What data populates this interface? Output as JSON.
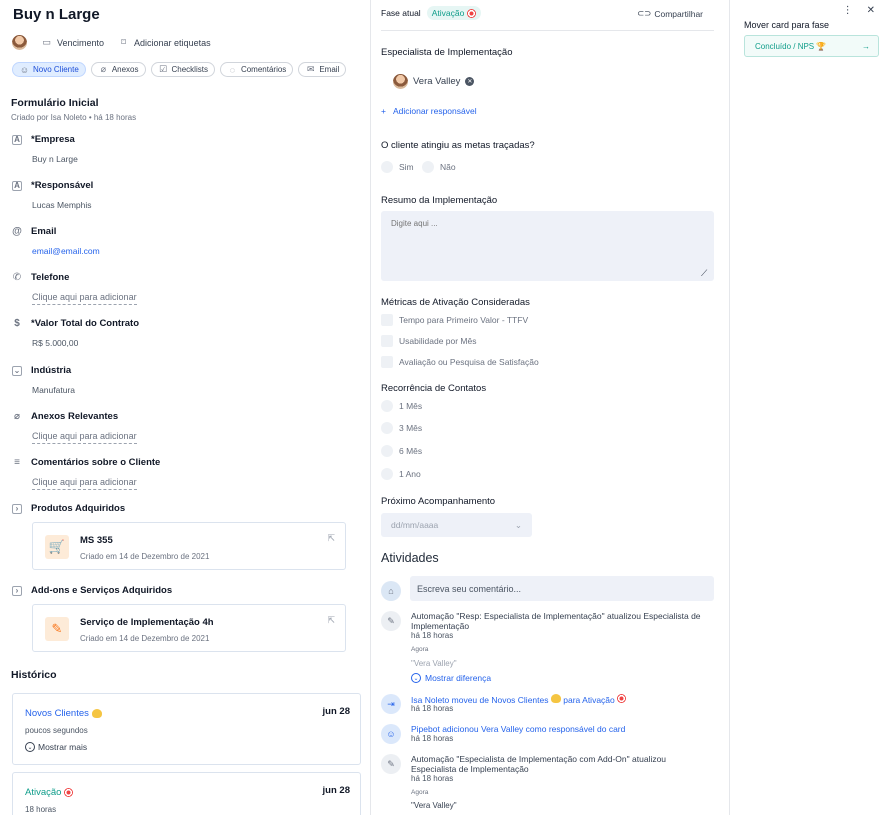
{
  "card": {
    "title": "Buy n Large",
    "due_label": "Vencimento",
    "tags_label": "Adicionar etiquetas"
  },
  "tabs": [
    "Novo Cliente",
    "Anexos",
    "Checklists",
    "Comentários",
    "Email"
  ],
  "form": {
    "title": "Formulário Inicial",
    "created": "Criado por Isa Noleto • há 18 horas",
    "fields": {
      "empresa": {
        "label": "*Empresa",
        "value": "Buy n Large"
      },
      "responsavel": {
        "label": "*Responsável",
        "value": "Lucas Memphis"
      },
      "email": {
        "label": "Email",
        "value": "email@email.com"
      },
      "telefone": {
        "label": "Telefone",
        "value": "Clique aqui para adicionar"
      },
      "valor": {
        "label": "*Valor Total do Contrato",
        "value": "R$ 5.000,00"
      },
      "industria": {
        "label": "Indústria",
        "value": "Manufatura"
      },
      "anexos": {
        "label": "Anexos Relevantes",
        "value": "Clique aqui para adicionar"
      },
      "comentarios": {
        "label": "Comentários sobre o Cliente",
        "value": "Clique aqui para adicionar"
      },
      "produtos": {
        "label": "Produtos Adquiridos"
      },
      "addons": {
        "label": "Add-ons e Serviços Adquiridos"
      }
    },
    "produto_card": {
      "name": "MS 355",
      "date": "Criado em 14 de Dezembro de 2021"
    },
    "addon_card": {
      "name": "Serviço de Implementação 4h",
      "date": "Criado em 14 de Dezembro de 2021"
    }
  },
  "history": {
    "title": "Histórico",
    "items": [
      {
        "phase": "Novos Clientes",
        "date": "jun 28",
        "when": "poucos segundos",
        "more": "Mostrar mais"
      },
      {
        "phase": "Ativação",
        "date": "jun 28",
        "when": "18 horas"
      }
    ]
  },
  "phase": {
    "label": "Fase atual",
    "current": "Ativação",
    "share": "Compartilhar"
  },
  "implementation": {
    "specialist_label": "Especialista de Implementação",
    "specialist_name": "Vera Valley",
    "add_responsible": "Adicionar responsável",
    "goals_question": "O cliente atingiu as metas traçadas?",
    "goals_options": [
      "Sim",
      "Não"
    ],
    "summary_label": "Resumo da Implementação",
    "summary_placeholder": "Digite aqui ...",
    "metrics_label": "Métricas de Ativação Consideradas",
    "metrics": [
      "Tempo para Primeiro Valor - TTFV",
      "Usabilidade por Mês",
      "Avaliação ou Pesquisa de Satisfação"
    ],
    "recurrence_label": "Recorrência de Contatos",
    "recurrence": [
      "1 Mês",
      "3 Mês",
      "6 Mês",
      "1 Ano"
    ],
    "next_label": "Próximo Acompanhamento",
    "next_placeholder": "dd/mm/aaaa"
  },
  "activities": {
    "title": "Atividades",
    "comment_placeholder": "Escreva seu comentário...",
    "items": [
      {
        "text": "Automação \"Resp: Especialista de Implementação\" atualizou Especialista de Implementação",
        "time": "há 18 horas",
        "small": "Agora",
        "quote": "\"Vera Valley\"",
        "diff": "Mostrar diferença"
      },
      {
        "text": "Isa Noleto moveu de Novos Clientes",
        "text2": "para Ativação",
        "time": "há 18 horas"
      },
      {
        "text": "Pipebot adicionou Vera Valley como responsável do card",
        "time": "há 18 horas"
      },
      {
        "text": "Automação \"Especialista de Implementação com Add-On\" atualizou Especialista de Implementação",
        "time": "há 18 horas",
        "small": "Agora",
        "quote": "\"Vera Valley\""
      }
    ]
  },
  "move": {
    "label": "Mover card para fase",
    "target": "Concluído / NPS"
  }
}
